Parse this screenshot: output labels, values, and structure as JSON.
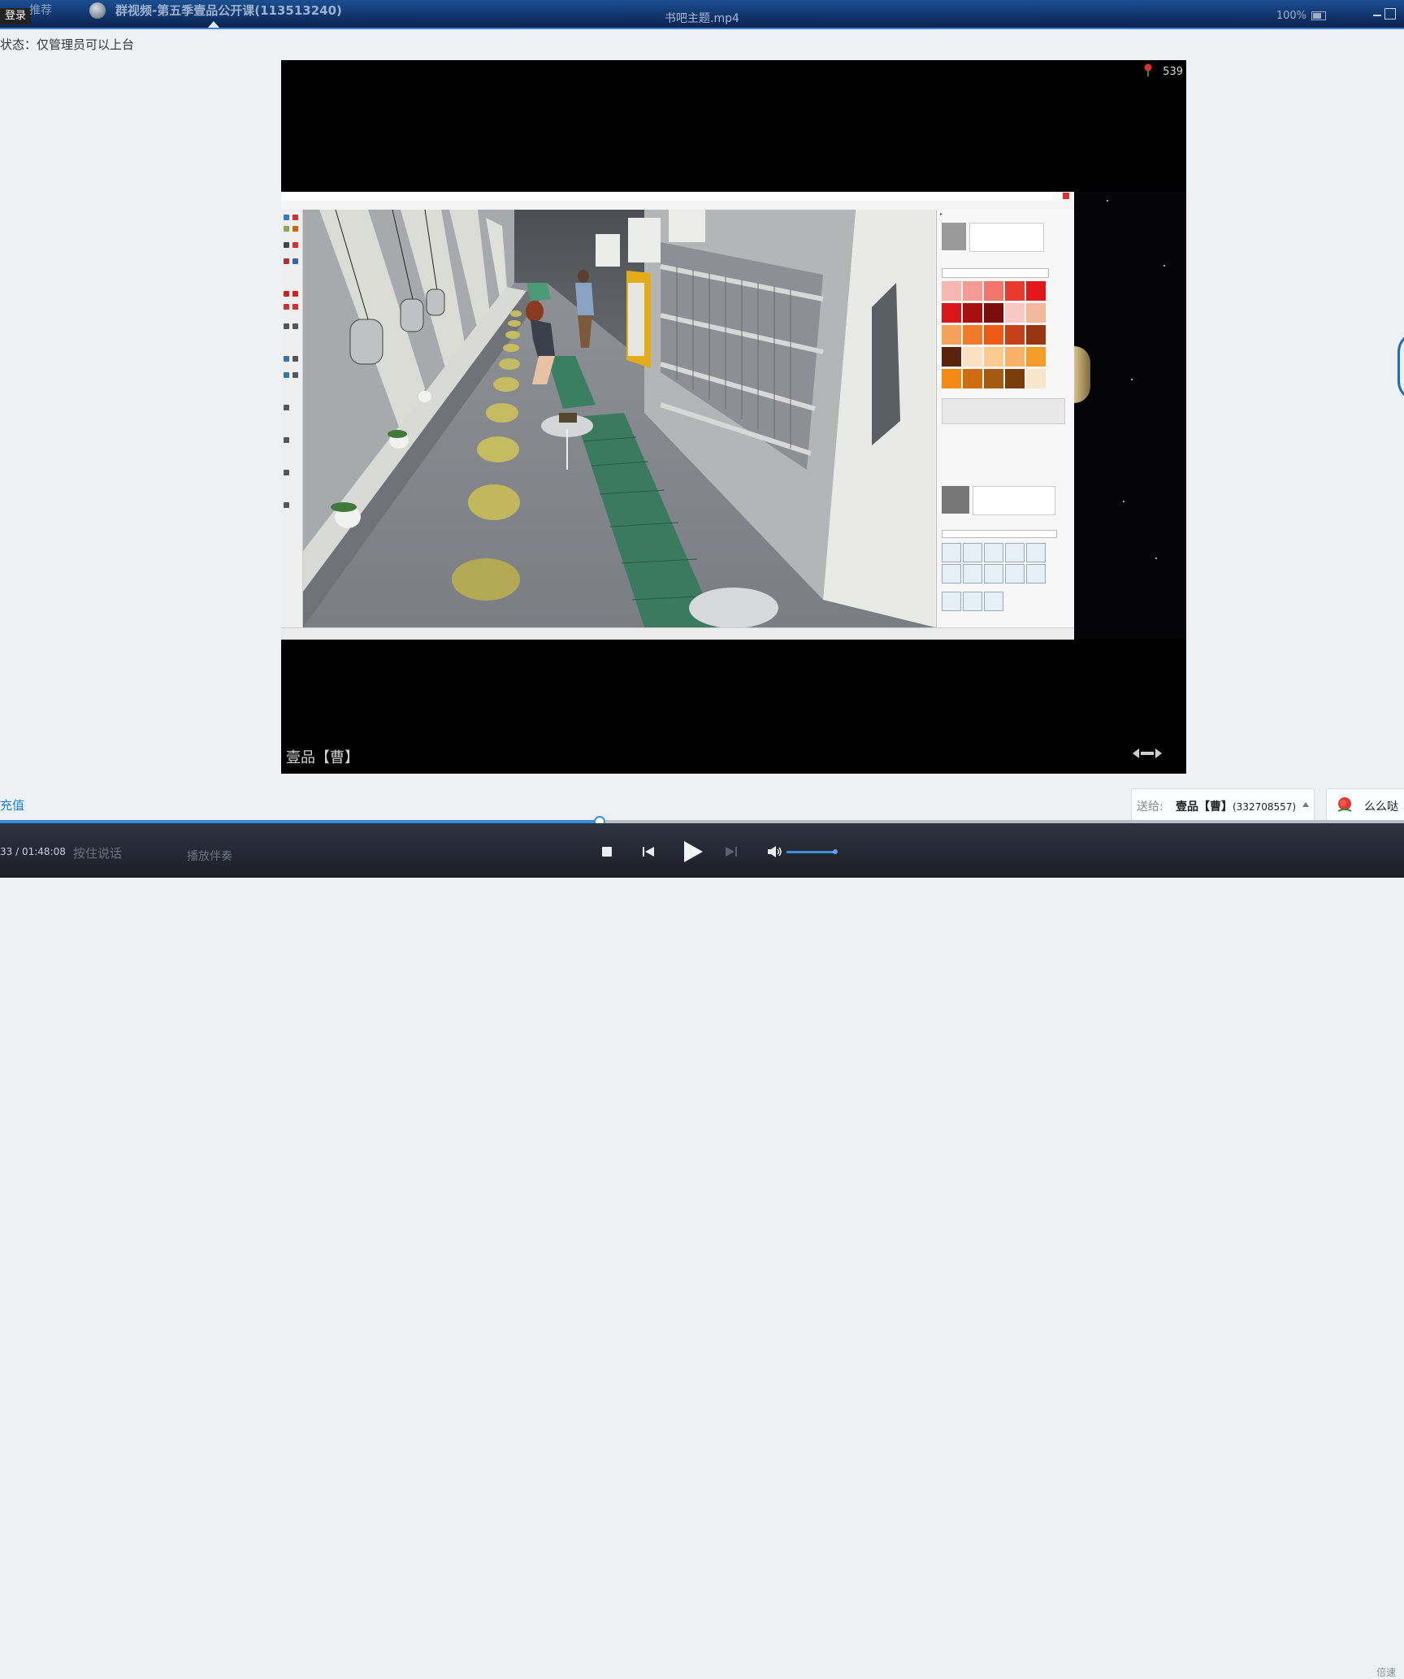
{
  "top_bar": {
    "login_label": "登录",
    "recommend_label": "推荐",
    "channel_title": "群视频-第五季壹品公开课(113513240)",
    "file_name": "书吧主题.mp4",
    "zoom": "100%"
  },
  "status_text": "状态：仅管理员可以上台",
  "video": {
    "flower_count": "539",
    "presenter_name": "壹品【曹】"
  },
  "recharge_label": "充值",
  "send": {
    "label": "送给:",
    "target_name": "壹品【曹】",
    "target_id": "(332708557)"
  },
  "gift_label": "么么哒",
  "player": {
    "progress_percent": 42.6,
    "time_current": "33",
    "time_total": "01:48:08",
    "volume_percent": 92,
    "press_to_talk_label": "按住说话",
    "play_mode_label": "播放伴奏",
    "speed_label": "倍速"
  },
  "colors": {
    "accent": "#3b8de0",
    "topbar": "#0f2f63",
    "link": "#1a7fd6"
  },
  "swatch_colors": [
    "#f6b8b0",
    "#f49a92",
    "#f2746a",
    "#e8392e",
    "#e3171a",
    "#d81818",
    "#a80f0f",
    "#7a0c0c",
    "#f7c9c2",
    "#f4b79c",
    "#f5a059",
    "#f07a2a",
    "#ee5a14",
    "#c6411a",
    "#9a3512",
    "#5a240c",
    "#fde0c3",
    "#fcc98e",
    "#f9b168",
    "#f69c28",
    "#f38a14",
    "#cf6d0e",
    "#a55a10",
    "#7a3e0a",
    "#f8e6cc"
  ]
}
